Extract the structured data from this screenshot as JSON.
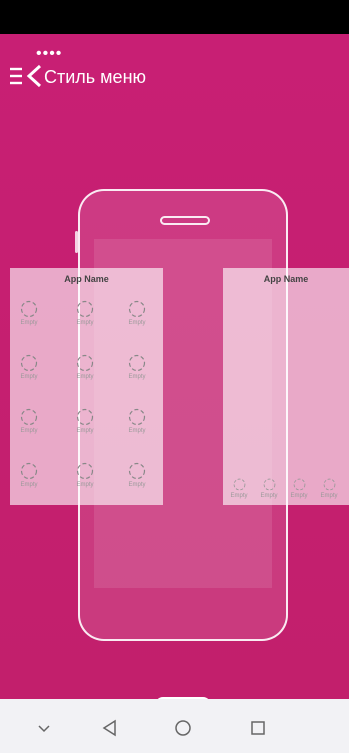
{
  "status_bar": {
    "dots": "••••"
  },
  "header": {
    "title": "Стиль меню"
  },
  "preview": {
    "left_panel": {
      "app_name": "App Name",
      "cells": [
        "Empty",
        "Empty",
        "Empty",
        "Empty",
        "Empty",
        "Empty",
        "Empty",
        "Empty",
        "Empty",
        "Empty",
        "Empty",
        "Empty"
      ]
    },
    "right_panel": {
      "app_name": "App Name",
      "cells": [
        "Empty",
        "Empty",
        "Empty",
        "Empty"
      ]
    }
  },
  "colors": {
    "background": "#c81f74"
  },
  "nav_bar": {
    "icons": [
      "chevron-down-icon",
      "back-triangle-icon",
      "home-circle-icon",
      "recents-square-icon"
    ]
  }
}
